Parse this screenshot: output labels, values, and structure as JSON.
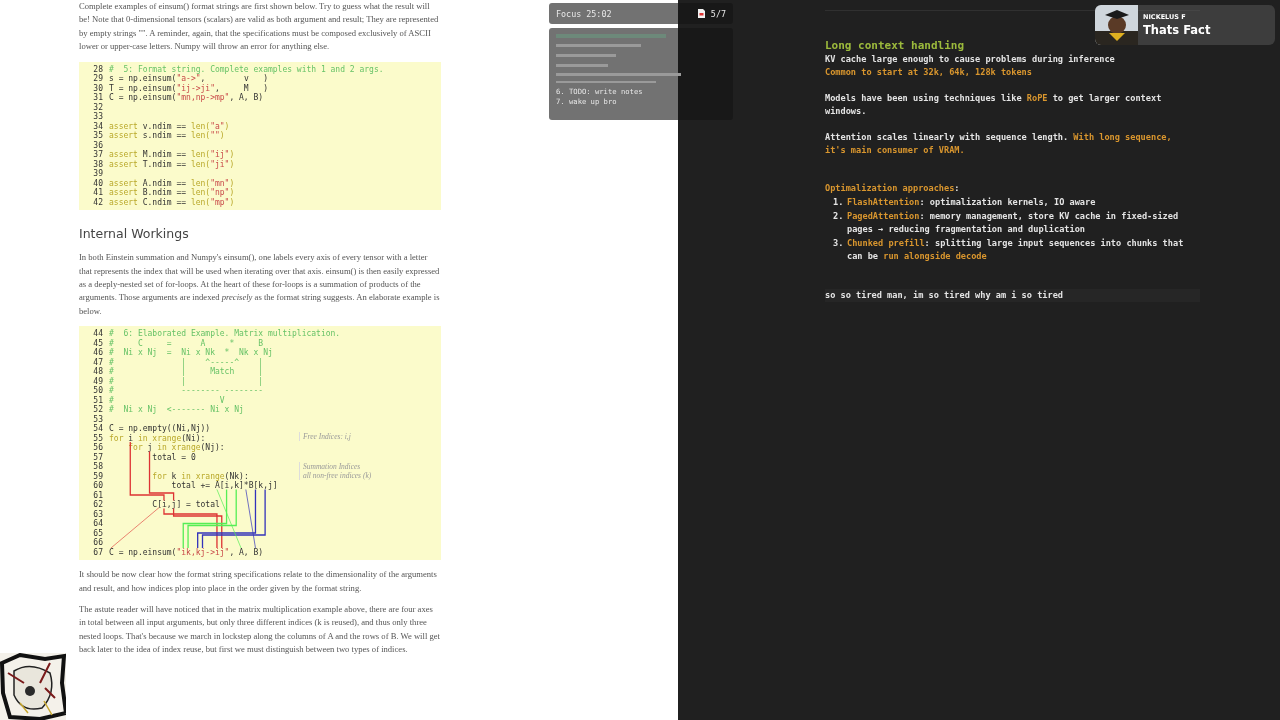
{
  "article": {
    "content": [
      {
        "kind": "paragraph",
        "text": "Complete examples of einsum() format strings are first shown below. Try to guess what the result will be! Note that 0-dimensional tensors (scalars) are valid as both argument and result; They are represented by empty strings \"\". A reminder, again, that the specifications must be composed exclusively of ASCII lower or upper-case letters. Numpy will throw an error for anything else."
      },
      {
        "kind": "code",
        "lines": [
          {
            "number": "28",
            "segments": [
              {
                "kind": "comment",
                "text": "#  5: Format string. Complete examples with 1 and 2 args."
              }
            ]
          },
          {
            "number": "29",
            "segments": [
              {
                "kind": "plain",
                "text": "s = np.einsum("
              },
              {
                "kind": "string",
                "text": "\"a->\""
              },
              {
                "kind": "plain",
                "text": ",        v   )"
              }
            ]
          },
          {
            "number": "30",
            "segments": [
              {
                "kind": "plain",
                "text": "T = np.einsum("
              },
              {
                "kind": "string",
                "text": "\"ij->ji\""
              },
              {
                "kind": "plain",
                "text": ",     M   )"
              }
            ]
          },
          {
            "number": "31",
            "segments": [
              {
                "kind": "plain",
                "text": "C = np.einsum("
              },
              {
                "kind": "string",
                "text": "\"mn,np->mp\""
              },
              {
                "kind": "plain",
                "text": ", A, B)"
              }
            ]
          },
          {
            "number": "32"
          },
          {
            "number": "33"
          },
          {
            "number": "34",
            "segments": [
              {
                "kind": "keyword",
                "text": "assert"
              },
              {
                "kind": "plain",
                "text": " v.ndim == "
              },
              {
                "kind": "keyword",
                "text": "len("
              },
              {
                "kind": "string",
                "text": "\"a\""
              },
              {
                "kind": "keyword",
                "text": ")"
              }
            ]
          },
          {
            "number": "35",
            "segments": [
              {
                "kind": "keyword",
                "text": "assert"
              },
              {
                "kind": "plain",
                "text": " s.ndim == "
              },
              {
                "kind": "keyword",
                "text": "len("
              },
              {
                "kind": "string",
                "text": "\"\""
              },
              {
                "kind": "keyword",
                "text": ")"
              }
            ]
          },
          {
            "number": "36"
          },
          {
            "number": "37",
            "segments": [
              {
                "kind": "keyword",
                "text": "assert"
              },
              {
                "kind": "plain",
                "text": " M.ndim == "
              },
              {
                "kind": "keyword",
                "text": "len("
              },
              {
                "kind": "string",
                "text": "\"ij\""
              },
              {
                "kind": "keyword",
                "text": ")"
              }
            ]
          },
          {
            "number": "38",
            "segments": [
              {
                "kind": "keyword",
                "text": "assert"
              },
              {
                "kind": "plain",
                "text": " T.ndim == "
              },
              {
                "kind": "keyword",
                "text": "len("
              },
              {
                "kind": "string",
                "text": "\"ji\""
              },
              {
                "kind": "keyword",
                "text": ")"
              }
            ]
          },
          {
            "number": "39"
          },
          {
            "number": "40",
            "segments": [
              {
                "kind": "keyword",
                "text": "assert"
              },
              {
                "kind": "plain",
                "text": " A.ndim == "
              },
              {
                "kind": "keyword",
                "text": "len("
              },
              {
                "kind": "string",
                "text": "\"mn\""
              },
              {
                "kind": "keyword",
                "text": ")"
              }
            ]
          },
          {
            "number": "41",
            "segments": [
              {
                "kind": "keyword",
                "text": "assert"
              },
              {
                "kind": "plain",
                "text": " B.ndim == "
              },
              {
                "kind": "keyword",
                "text": "len("
              },
              {
                "kind": "string",
                "text": "\"np\""
              },
              {
                "kind": "keyword",
                "text": ")"
              }
            ]
          },
          {
            "number": "42",
            "segments": [
              {
                "kind": "keyword",
                "text": "assert"
              },
              {
                "kind": "plain",
                "text": " C.ndim == "
              },
              {
                "kind": "keyword",
                "text": "len("
              },
              {
                "kind": "string",
                "text": "\"mp\""
              },
              {
                "kind": "keyword",
                "text": ")"
              }
            ]
          }
        ]
      },
      {
        "kind": "heading",
        "text": "Internal Workings"
      },
      {
        "kind": "paragraph",
        "text": "In both Einstein summation and Numpy's einsum(), one labels every axis of every tensor with a letter that represents the index that will be used when iterating over that axis. einsum() is then easily expressed as a deeply-nested set of for-loops. At the heart of these for-loops is a summation of products of the arguments. Those arguments are indexed *precisely* as the format string suggests. An elaborate example is below."
      },
      {
        "kind": "annotated_code",
        "lines": [
          {
            "number": "44",
            "segments": [
              {
                "kind": "comment",
                "text": "#  6: Elaborated Example. Matrix multiplication."
              }
            ]
          },
          {
            "number": "45",
            "segments": [
              {
                "kind": "comment",
                "text": "#     C     =      A     *     B"
              }
            ]
          },
          {
            "number": "46",
            "segments": [
              {
                "kind": "comment",
                "text": "#  Ni x Nj  =  Ni x Nk  *  Nk x Nj"
              }
            ]
          },
          {
            "number": "47",
            "segments": [
              {
                "kind": "comment",
                "text": "#              |    ^-----^    |"
              }
            ]
          },
          {
            "number": "48",
            "segments": [
              {
                "kind": "comment",
                "text": "#              |     Match     |"
              }
            ]
          },
          {
            "number": "49",
            "segments": [
              {
                "kind": "comment",
                "text": "#              |               |"
              }
            ]
          },
          {
            "number": "50",
            "segments": [
              {
                "kind": "comment",
                "text": "#              -------- --------"
              }
            ]
          },
          {
            "number": "51",
            "segments": [
              {
                "kind": "comment",
                "text": "#                      V"
              }
            ]
          },
          {
            "number": "52",
            "segments": [
              {
                "kind": "comment",
                "text": "#  Ni x Nj  <------- Ni x Nj"
              }
            ]
          },
          {
            "number": "53"
          },
          {
            "number": "54",
            "segments": [
              {
                "kind": "plain",
                "text": "C = np.empty((Ni,Nj))"
              }
            ]
          },
          {
            "number": "55",
            "segments": [
              {
                "kind": "keyword",
                "text": "for"
              },
              {
                "kind": "plain",
                "text": " i "
              },
              {
                "kind": "keyword",
                "text": "in xrange"
              },
              {
                "kind": "plain",
                "text": "(Ni):"
              }
            ]
          },
          {
            "number": "56",
            "segments": [
              {
                "kind": "keyword",
                "text": "    for"
              },
              {
                "kind": "plain",
                "text": " j "
              },
              {
                "kind": "keyword",
                "text": "in xrange"
              },
              {
                "kind": "plain",
                "text": "(Nj):"
              }
            ]
          },
          {
            "number": "57",
            "segments": [
              {
                "kind": "plain",
                "text": "         total = 0"
              }
            ]
          },
          {
            "number": "58"
          },
          {
            "number": "59",
            "segments": [
              {
                "kind": "keyword",
                "text": "         for"
              },
              {
                "kind": "plain",
                "text": " k "
              },
              {
                "kind": "keyword",
                "text": "in xrange"
              },
              {
                "kind": "plain",
                "text": "(Nk):"
              }
            ]
          },
          {
            "number": "60",
            "segments": [
              {
                "kind": "plain",
                "text": "             total += A[i,k]*B[k,j]"
              }
            ]
          },
          {
            "number": "61"
          },
          {
            "number": "62",
            "segments": [
              {
                "kind": "plain",
                "text": "         C[i,j] = total"
              }
            ]
          },
          {
            "number": "63"
          },
          {
            "number": "64"
          },
          {
            "number": "65"
          },
          {
            "number": "66"
          },
          {
            "number": "67",
            "segments": [
              {
                "kind": "plain",
                "text": "C = np.einsum("
              },
              {
                "kind": "string",
                "text": "\"ik,kj->ij\""
              },
              {
                "kind": "plain",
                "text": ", A, B)"
              }
            ]
          }
        ],
        "annotations": [
          {
            "text": "Free Indices: i,j"
          },
          {
            "text": "Summation Indices\nall non-free indices (k)"
          }
        ]
      },
      {
        "kind": "paragraph",
        "text": "It should be now clear how the format string specifications relate to the dimensionality of the arguments and result, and how indices plop into place in the order given by the format string."
      },
      {
        "kind": "paragraph",
        "text": "The astute reader will have noticed that in the matrix multiplication example above, there are four axes in total between all input arguments, but only three different indices (k is reused), and thus only three nested loops. That's because we march in lockstep along the columns of A and the rows of B. We will get back later to the idea of index reuse, but first we must distinguish between two types of indices."
      }
    ]
  },
  "focus": {
    "title": "Focus 25:02",
    "count": "5/7",
    "tasks": [
      {
        "text": "6. TODO: write notes"
      },
      {
        "text": "7. wake up bro"
      }
    ]
  },
  "notification": {
    "name": "NICKELUS F",
    "message": "Thats Fact"
  },
  "notes": {
    "heading": "Long context handling",
    "blocks": [
      {
        "lines": [
          {
            "text": "KV cache large enough to cause problems during inference",
            "highlight": false
          },
          {
            "text": "Common to start at 32k, 64k, 128k tokens",
            "highlight": true
          }
        ]
      },
      {
        "lines": [
          {
            "text": "Models have been using techniques like **RoPE** to get larger context windows.",
            "highlight": false
          }
        ]
      },
      {
        "lines": [
          {
            "text": "Attention scales linearly with sequence length. **With long sequence, it's main consumer of VRAM.**",
            "highlight": false
          }
        ]
      }
    ],
    "list_heading": "**Optimalization approaches**:",
    "list": [
      {
        "number": "1.",
        "text": "**FlashAttention**: optimalization kernels, IO aware"
      },
      {
        "number": "2.",
        "text": "**PagedAttention**: memory management, store KV cache in fixed-sized pages → reducing fragmentation and duplication"
      },
      {
        "number": "3.",
        "text": "**Chunked prefill**: splitting large input sequences into chunks that can be **run alongside decode**"
      }
    ],
    "input": {
      "value": "so so tired man, im so tired why am i so tired"
    }
  }
}
